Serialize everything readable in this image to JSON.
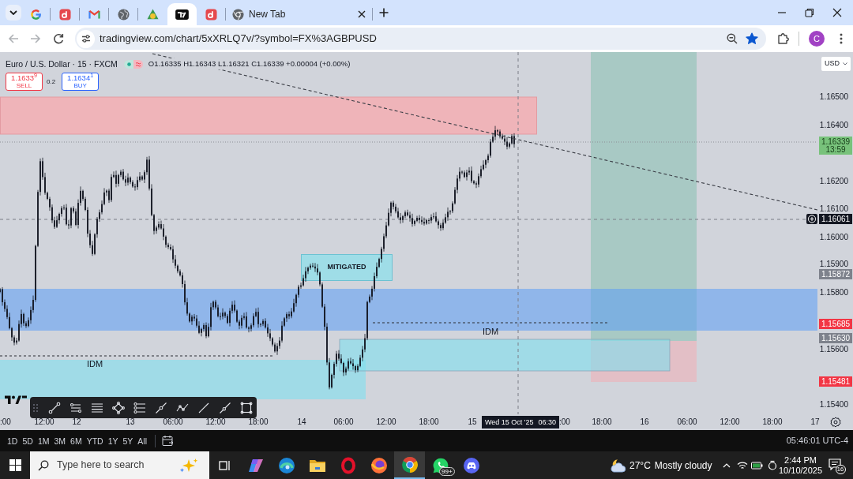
{
  "browser": {
    "tabs": [
      {
        "selected": false
      },
      {
        "selected": false
      },
      {
        "selected": false
      },
      {
        "selected": false
      },
      {
        "selected": false
      },
      {
        "selected": true
      },
      {
        "selected": false
      },
      {
        "title": "New Tab",
        "selected": false
      }
    ],
    "back": {
      "disabled": true
    },
    "forward": {
      "disabled": true
    },
    "url": "tradingview.com/chart/5xXRLQ7v/?symbol=FX%3AGBPUSD",
    "bookmarked": true,
    "profile": "C"
  },
  "chart": {
    "symbol": "Euro / U.S. Dollar · 15 · FXCM",
    "ohlc": "O1.16335 H1.16343 L1.16321 C1.16339 +0.00004 (+0.00%)",
    "sell": {
      "price": "1.1633$^{9}$",
      "label": "SELL"
    },
    "spread": "0.2",
    "buy": {
      "price": "1.1634$^{1}$",
      "label": "BUY"
    },
    "currency": "USD",
    "mitigated_label": "MITIGATED",
    "idm_labels": [
      "IDM",
      "IDM"
    ],
    "price_ticks": [
      "1.16500",
      "1.16400",
      "1.16200",
      "1.16100",
      "1.16000",
      "1.15900",
      "1.15800",
      "1.15600",
      "1.15400"
    ],
    "price_badges": [
      {
        "kind": "last",
        "price": "1.16339",
        "countdown": "13:59",
        "color": "#78c27b"
      },
      {
        "kind": "crosshair",
        "price": "1.16061",
        "color": "#131722"
      },
      {
        "kind": "level",
        "price": "1.15872",
        "color": "#7e828c"
      },
      {
        "kind": "level",
        "price": "1.15685",
        "color": "#f23645"
      },
      {
        "kind": "level",
        "price": "1.15630",
        "color": "#7e828c"
      },
      {
        "kind": "level",
        "price": "1.15481",
        "color": "#f23645"
      }
    ],
    "time_ticks": [
      ":00",
      "12:00",
      "12",
      "13",
      "06:00",
      "12:00",
      "18:00",
      "14",
      "06:00",
      "12:00",
      "18:00",
      "15",
      ":00",
      "18:00",
      "16",
      "06:00",
      "12:00",
      "18:00",
      "17"
    ],
    "crosshair_time": {
      "date": "Wed 15 Oct '25",
      "time": "06:30"
    }
  },
  "bottom_bar": {
    "ranges": [
      "1D",
      "5D",
      "1M",
      "3M",
      "6M",
      "YTD",
      "1Y",
      "5Y",
      "All"
    ],
    "clock": "05:46:01 UTC-4"
  },
  "taskbar": {
    "search": {
      "placeholder": "Type here to search"
    },
    "apps": [
      {
        "selected": false
      },
      {
        "selected": false
      },
      {
        "selected": false
      },
      {
        "selected": false
      },
      {
        "selected": false
      },
      {
        "selected": false
      },
      {
        "selected": true
      },
      {
        "selected": false,
        "badge": "99+"
      },
      {
        "selected": false
      }
    ],
    "weather": {
      "temperature": "27°C",
      "condition": "Mostly cloudy"
    },
    "clock": {
      "time": "2:44 PM",
      "date": "10/10/2025"
    },
    "notifications": "16"
  }
}
